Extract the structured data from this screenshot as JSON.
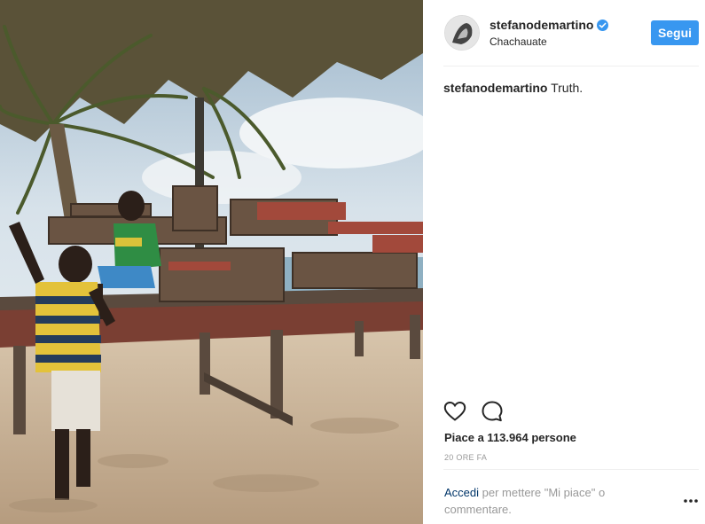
{
  "post": {
    "username": "stefanodemartino",
    "location": "Chachauate",
    "follow_label": "Segui",
    "caption_user": "stefanodemartino",
    "caption_text": "Truth.",
    "likes": "Piace a 113.964 persone",
    "time": "20 ORE FA",
    "login_link": "Accedi",
    "login_text": " per mettere \"Mi piace\" o commentare."
  },
  "icons": {
    "like": "heart-icon",
    "comment": "comment-icon",
    "verified": "verified-badge-icon",
    "more": "more-options-icon"
  },
  "colors": {
    "accent": "#3897f0",
    "text": "#262626",
    "muted": "#999999",
    "link": "#003569"
  }
}
